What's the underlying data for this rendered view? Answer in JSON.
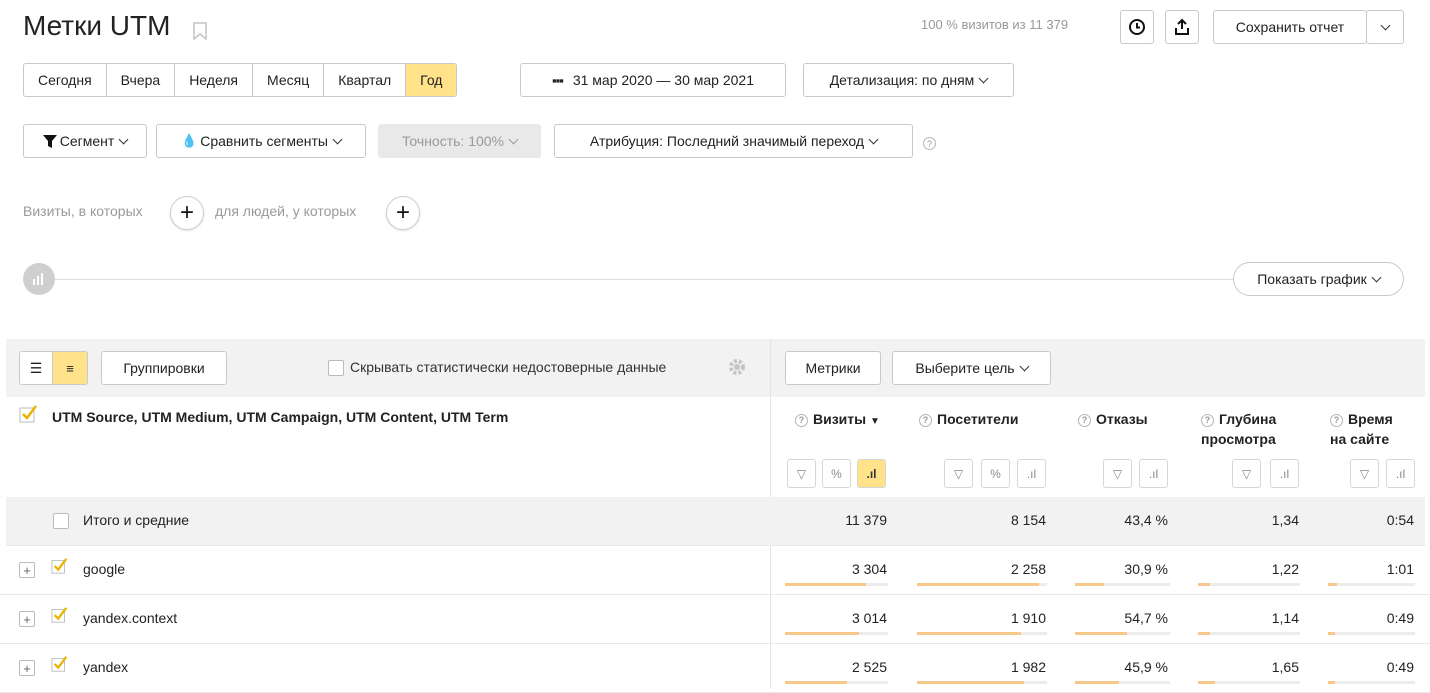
{
  "header": {
    "title": "Метки UTM",
    "visits_info": "100 % визитов из 11 379",
    "save_report": "Сохранить отчет"
  },
  "periods": [
    {
      "label": "Сегодня",
      "active": false
    },
    {
      "label": "Вчера",
      "active": false
    },
    {
      "label": "Неделя",
      "active": false
    },
    {
      "label": "Месяц",
      "active": false
    },
    {
      "label": "Квартал",
      "active": false
    },
    {
      "label": "Год",
      "active": true
    }
  ],
  "date_range": "31 мар 2020 — 30 мар 2021",
  "detail": "Детализация: по дням",
  "segment": "Сегмент",
  "compare": "Сравнить сегменты",
  "accuracy": "Точность: 100%",
  "attribution": "Атрибуция: Последний значимый переход",
  "filters": {
    "visits_where": "Визиты, в которых",
    "people_where": "для людей, у которых"
  },
  "show_chart": "Показать график",
  "toolbar": {
    "groupings": "Группировки",
    "hide_unreliable": "Скрывать статистически недостоверные данные",
    "metrics": "Метрики",
    "choose_goal": "Выберите цель"
  },
  "table": {
    "dimension_header": "UTM Source, UTM Medium, UTM Campaign, UTM Content, UTM Term",
    "columns": {
      "visits": "Визиты",
      "visitors": "Посетители",
      "bounces": "Отказы",
      "depth_1": "Глубина",
      "depth_2": "просмотра",
      "time_1": "Время",
      "time_2": "на сайте"
    },
    "totals": {
      "label": "Итого и средние",
      "visits": "11 379",
      "visitors": "8 154",
      "bounces": "43,4 %",
      "depth": "1,34",
      "time": "0:54"
    },
    "rows": [
      {
        "name": "google",
        "visits": "3 304",
        "visitors": "2 258",
        "bounces": "30,9 %",
        "depth": "1,22",
        "time": "1:01"
      },
      {
        "name": "yandex.context",
        "visits": "3 014",
        "visitors": "1 910",
        "bounces": "54,7 %",
        "depth": "1,14",
        "time": "0:49"
      },
      {
        "name": "yandex",
        "visits": "2 525",
        "visitors": "1 982",
        "bounces": "45,9 %",
        "depth": "1,65",
        "time": "0:49"
      }
    ]
  },
  "colors": {
    "accent": "#ffe28a",
    "bar": "#f6c98a",
    "check": "#e8b400"
  }
}
